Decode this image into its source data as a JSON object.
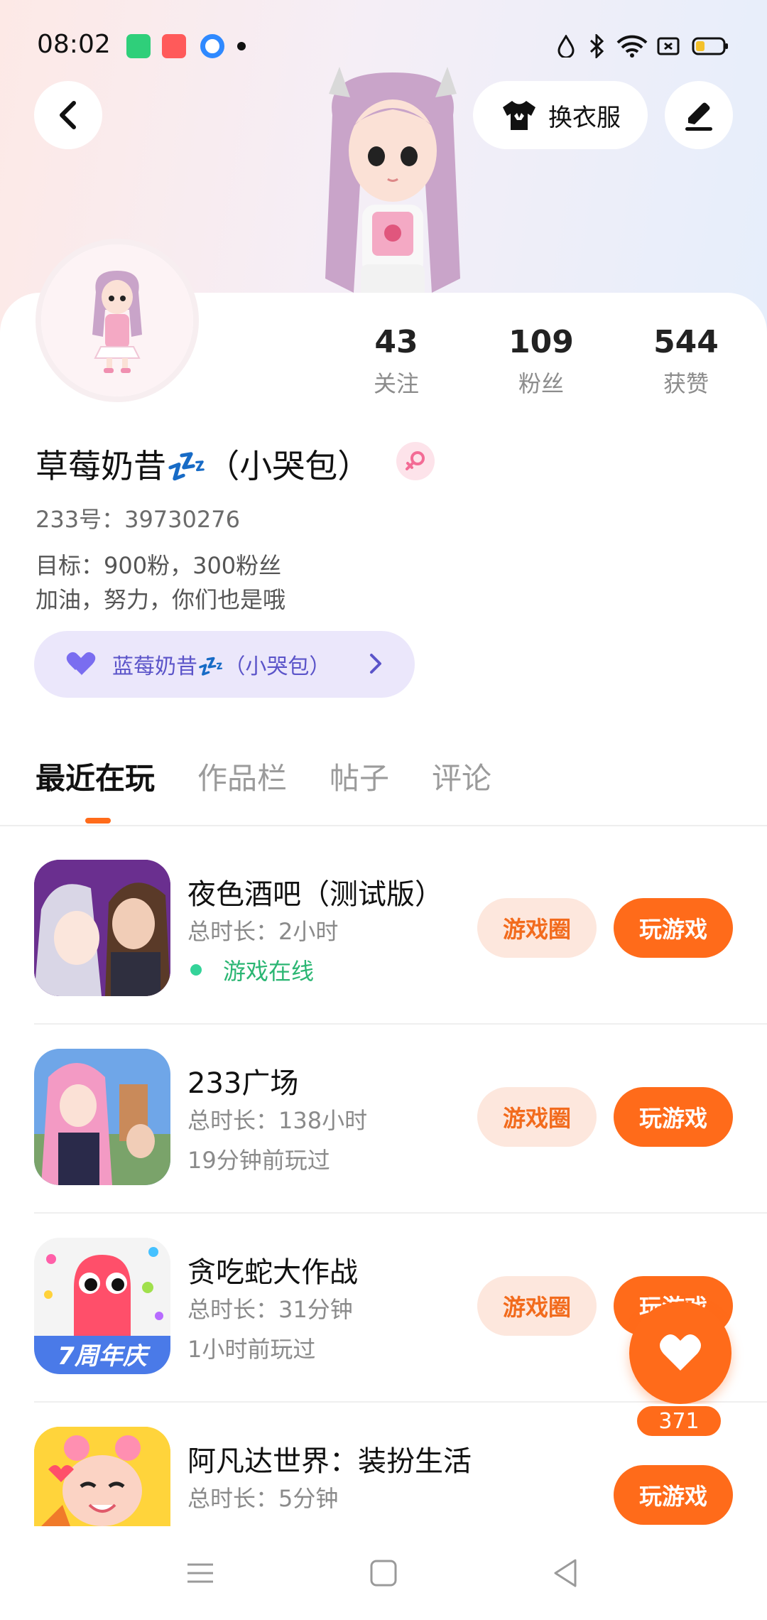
{
  "status_bar": {
    "time": "08:02"
  },
  "header": {
    "outfit_button": "换衣服"
  },
  "profile": {
    "stats": [
      {
        "value": "43",
        "label": "关注"
      },
      {
        "value": "109",
        "label": "粉丝"
      },
      {
        "value": "544",
        "label": "获赞"
      }
    ],
    "name": "草莓奶昔💤（小哭包）",
    "uid": "233号：39730276",
    "bio_line1": "目标：900粉，300粉丝",
    "bio_line2": "加油，努力，你们也是哦",
    "partner_pill": "蓝莓奶昔💤（小哭包）"
  },
  "tabs": [
    {
      "label": "最近在玩"
    },
    {
      "label": "作品栏"
    },
    {
      "label": "帖子"
    },
    {
      "label": "评论"
    }
  ],
  "games": [
    {
      "title": "夜色酒吧（测试版）",
      "duration": "总时长：2小时",
      "status": "游戏在线",
      "circle": "游戏圈",
      "play": "玩游戏"
    },
    {
      "title": "233广场",
      "duration": "总时长：138小时",
      "status": "19分钟前玩过",
      "circle": "游戏圈",
      "play": "玩游戏"
    },
    {
      "title": "贪吃蛇大作战",
      "duration": "总时长：31分钟",
      "status": "1小时前玩过",
      "circle": "游戏圈",
      "play": "玩游戏"
    },
    {
      "title": "阿凡达世界：装扮生活",
      "duration": "总时长：5分钟",
      "play": "玩游戏"
    }
  ],
  "icon_texts": {
    "snake_anniversary": "7周年庆"
  },
  "like": {
    "count": "371"
  },
  "colors": {
    "accent": "#ff6b1a",
    "online": "#2bb673",
    "pill_text": "#5b54c9"
  }
}
